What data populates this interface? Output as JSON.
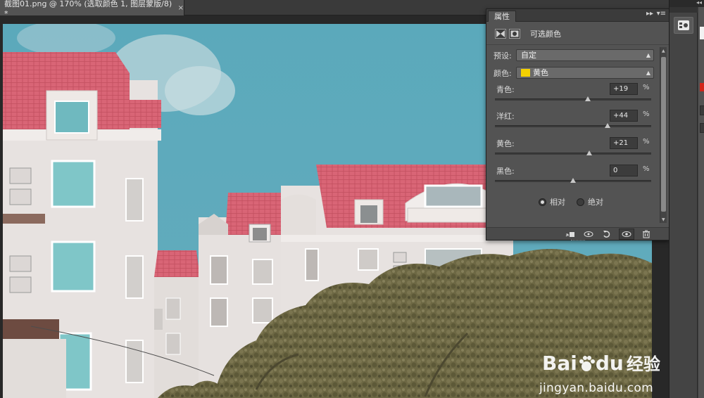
{
  "document": {
    "tab_title": "截图01.png @ 170% (选取颜色 1, 图层蒙版/8) *",
    "close_glyph": "×"
  },
  "panel": {
    "tab_label": "属性",
    "expand_glyph": "▸▸",
    "menu_glyph": "▾≡",
    "title": "可选颜色",
    "preset_label": "预设:",
    "preset_value": "自定",
    "colors_label": "颜色:",
    "colors_value": "黄色",
    "colors_swatch": "#f5d100",
    "sliders": [
      {
        "label": "青色:",
        "value": "+19",
        "unit": "%",
        "amount": 19
      },
      {
        "label": "洋红:",
        "value": "+44",
        "unit": "%",
        "amount": 44
      },
      {
        "label": "黄色:",
        "value": "+21",
        "unit": "%",
        "amount": 21
      },
      {
        "label": "黑色:",
        "value": "0",
        "unit": "%",
        "amount": 0
      }
    ],
    "method_relative": "相对",
    "method_absolute": "绝对",
    "method_selected": "relative"
  },
  "watermark": {
    "brand": "Bai",
    "brand_tail": "du",
    "brand_cn": "经验",
    "url": "jingyan.baidu.com"
  },
  "colors": {
    "sky": "#5aa6b8",
    "roof": "#d96576",
    "wall": "#e6e1df",
    "tree": "#6f6a45",
    "panel_bg": "#535353"
  }
}
